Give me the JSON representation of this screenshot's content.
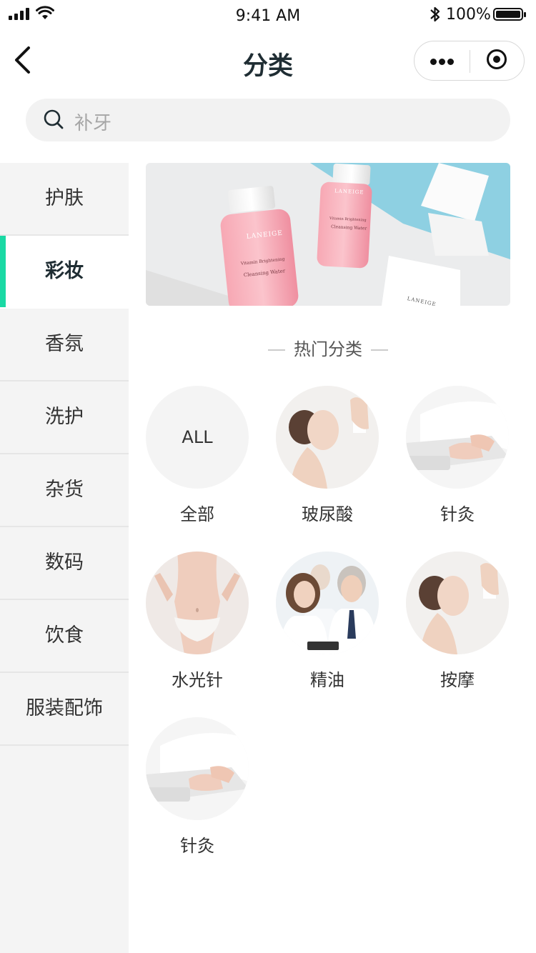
{
  "status_bar": {
    "time": "9:41 AM",
    "battery": "100%"
  },
  "nav": {
    "title": "分类",
    "back_icon": "chevron-left-icon",
    "more_icon": "more-dots-icon",
    "close_icon": "target-close-icon"
  },
  "search": {
    "placeholder": "补牙",
    "icon": "search-icon"
  },
  "sidebar": {
    "items": [
      {
        "label": "护肤",
        "active": false
      },
      {
        "label": "彩妆",
        "active": true
      },
      {
        "label": "香氛",
        "active": false
      },
      {
        "label": "洗护",
        "active": false
      },
      {
        "label": "杂货",
        "active": false
      },
      {
        "label": "数码",
        "active": false
      },
      {
        "label": "饮食",
        "active": false
      },
      {
        "label": "服装配饰",
        "active": false
      }
    ],
    "accent_color": "#1ad9a4"
  },
  "banner": {
    "brand": "LANEIGE",
    "product_line1": "Vitamin Brightening",
    "product_line2": "Cleansing Water"
  },
  "hot_categories": {
    "title": "热门分类",
    "items": [
      {
        "label": "全部",
        "image": "ALL"
      },
      {
        "label": "玻尿酸",
        "image": "woman-face-photo"
      },
      {
        "label": "针灸",
        "image": "acupuncture-photo"
      },
      {
        "label": "水光针",
        "image": "body-photo"
      },
      {
        "label": "精油",
        "image": "doctors-photo"
      },
      {
        "label": "按摩",
        "image": "woman-face-photo"
      },
      {
        "label": "针灸",
        "image": "acupuncture-photo"
      }
    ]
  }
}
